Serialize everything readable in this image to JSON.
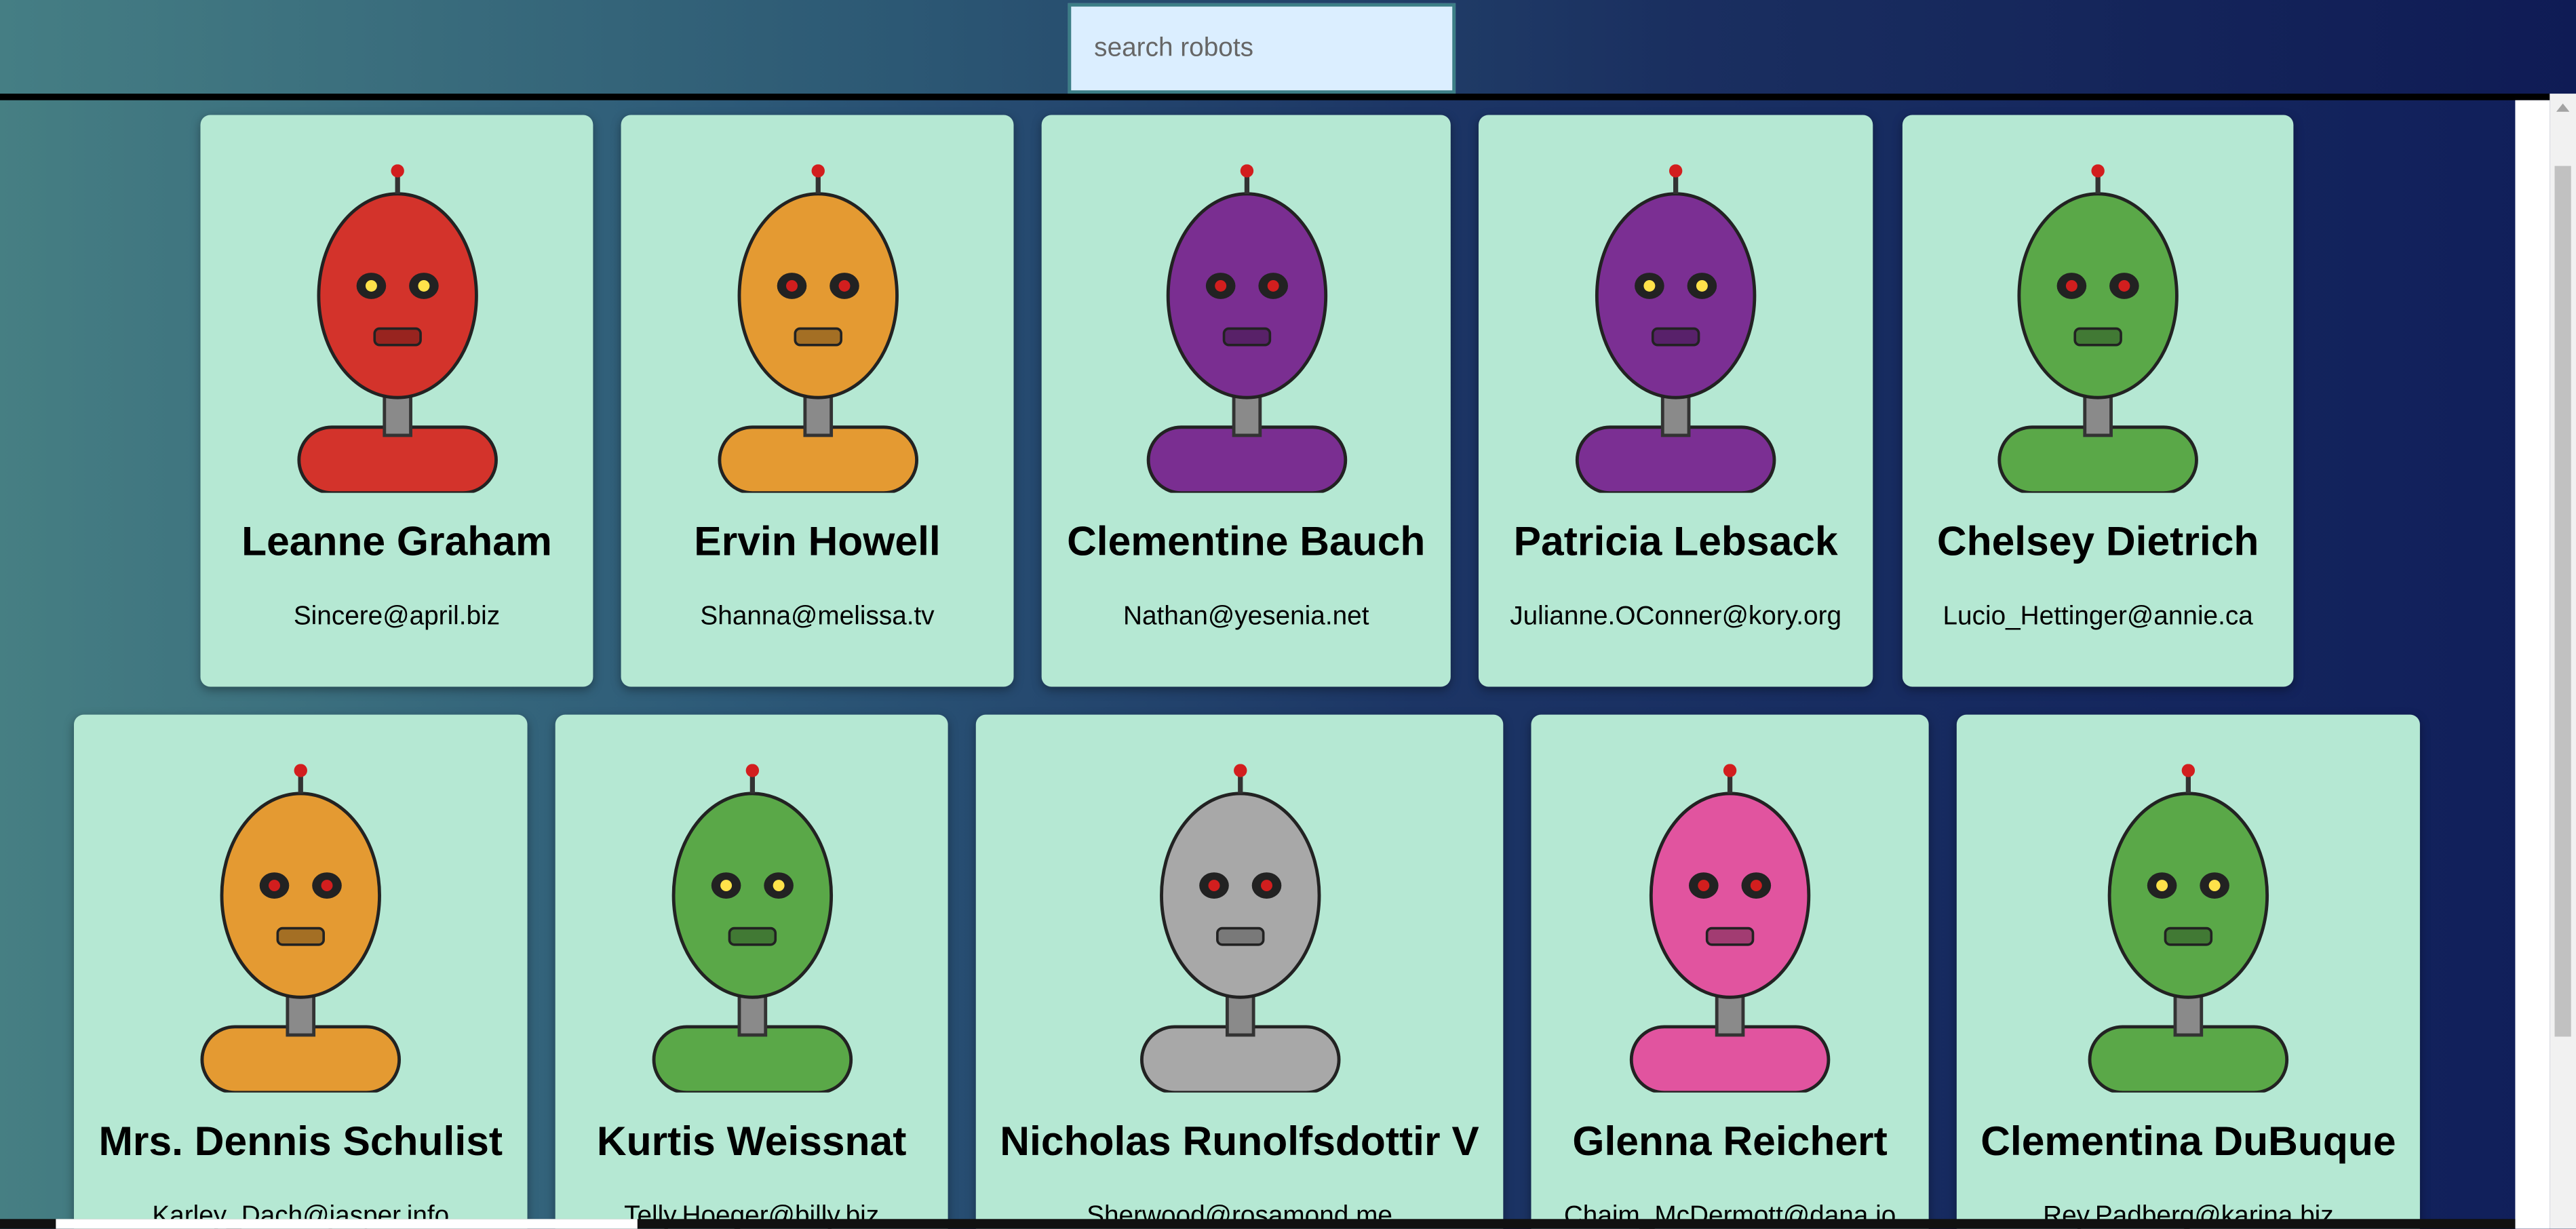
{
  "search": {
    "placeholder": "search robots",
    "value": ""
  },
  "robots": [
    {
      "name": "Leanne Graham",
      "email": "Sincere@april.biz",
      "color": "#d3332b"
    },
    {
      "name": "Ervin Howell",
      "email": "Shanna@melissa.tv",
      "color": "#e49a32"
    },
    {
      "name": "Clementine Bauch",
      "email": "Nathan@yesenia.net",
      "color": "#7a2e91"
    },
    {
      "name": "Patricia Lebsack",
      "email": "Julianne.OConner@kory.org",
      "color": "#7b2f93"
    },
    {
      "name": "Chelsey Dietrich",
      "email": "Lucio_Hettinger@annie.ca",
      "color": "#5aa848"
    },
    {
      "name": "Mrs. Dennis Schulist",
      "email": "Karley_Dach@jasper.info",
      "color": "#e49a32"
    },
    {
      "name": "Kurtis Weissnat",
      "email": "Telly.Hoeger@billy.biz",
      "color": "#5aa848"
    },
    {
      "name": "Nicholas Runolfsdottir V",
      "email": "Sherwood@rosamond.me",
      "color": "#a8a8a8"
    },
    {
      "name": "Glenna Reichert",
      "email": "Chaim_McDermott@dana.io",
      "color": "#e1549f"
    },
    {
      "name": "Clementina DuBuque",
      "email": "Rey.Padberg@karina.biz",
      "color": "#5aa848"
    }
  ],
  "icons": {
    "robot": "robot-avatar-icon"
  }
}
